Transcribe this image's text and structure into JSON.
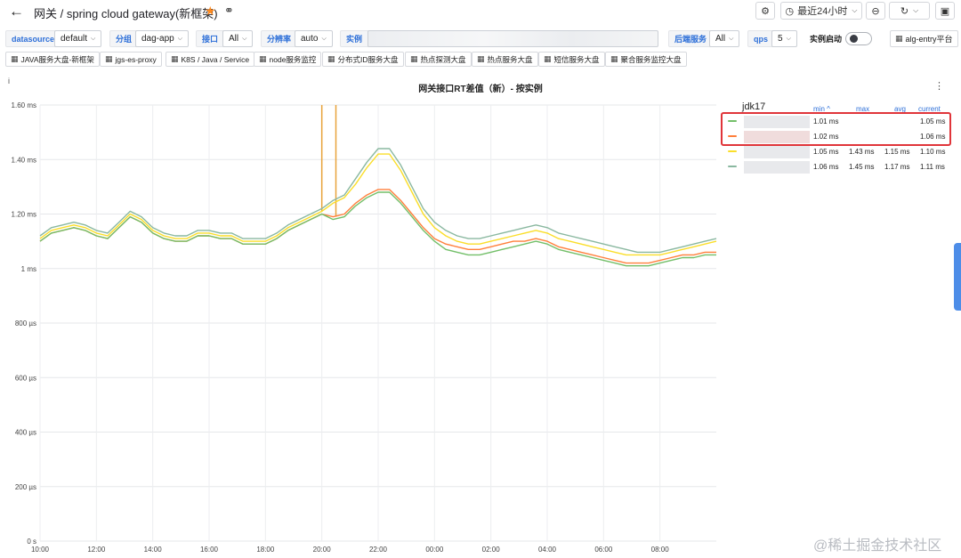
{
  "header": {
    "title": "网关 / spring cloud gateway(新框架)",
    "time_range": "最近24小时",
    "icons": [
      "back-arrow",
      "star",
      "share",
      "settings-gear",
      "clock",
      "zoom-out",
      "refresh",
      "monitor"
    ]
  },
  "variables": [
    {
      "label": "datasource",
      "value": "default",
      "dropdown": true
    },
    {
      "label": "分组",
      "value": "dag-app",
      "dropdown": true
    },
    {
      "label": "接口",
      "value": "All",
      "dropdown": true
    },
    {
      "label": "分辨率",
      "value": "auto",
      "dropdown": true
    },
    {
      "label": "实例",
      "value": ""
    },
    {
      "label": "后端服务",
      "value": "All",
      "dropdown": true
    },
    {
      "label": "qps",
      "value": "5",
      "dropdown": true
    },
    {
      "label": "实例启动",
      "value": ""
    }
  ],
  "alg_link": "alg-entry平台",
  "dashboard_links": [
    "JAVA服务大盘-新框架",
    "jgs-es-proxy",
    "K8S / Java / Service",
    "node服务监控",
    "分布式ID服务大盘",
    "热点探测大盘",
    "热点服务大盘",
    "短信服务大盘",
    "聚合服务监控大盘"
  ],
  "panel": {
    "info": "i",
    "title": "网关接口RT差值（新）- 按实例",
    "menu": "⋮"
  },
  "legend": {
    "title": "jdk17",
    "columns": {
      "min": "min ^",
      "max": "max",
      "avg": "avg",
      "current": "current"
    },
    "rows": [
      {
        "color": "#73bf69",
        "min": "1.01 ms",
        "max": "",
        "avg": "",
        "current": "1.05 ms"
      },
      {
        "color": "#ff7f3b",
        "min": "1.02 ms",
        "max": "",
        "avg": "",
        "current": "1.06 ms"
      },
      {
        "color": "#fade2a",
        "min": "1.05 ms",
        "max": "1.43 ms",
        "avg": "1.15 ms",
        "current": "1.10 ms"
      },
      {
        "color": "#8ab8a0",
        "min": "1.06 ms",
        "max": "1.45 ms",
        "avg": "1.17 ms",
        "current": "1.11 ms"
      }
    ]
  },
  "watermark": "@稀土掘金技术社区",
  "chart_data": {
    "type": "line",
    "y_ticks": [
      "1.60 ms",
      "1.40 ms",
      "1.20 ms",
      "1 ms",
      "800 µs",
      "600 µs",
      "400 µs",
      "200 µs",
      "0 s"
    ],
    "x_ticks": [
      "10:00",
      "12:00",
      "14:00",
      "16:00",
      "18:00",
      "20:00",
      "22:00",
      "00:00",
      "02:00",
      "04:00",
      "06:00",
      "08:00"
    ],
    "ylim": [
      0,
      1.6
    ],
    "y_unit": "ms",
    "x_hours": [
      0,
      0.4,
      0.8,
      1.2,
      1.6,
      2.0,
      2.4,
      2.8,
      3.2,
      3.6,
      4.0,
      4.4,
      4.8,
      5.2,
      5.6,
      6.0,
      6.4,
      6.8,
      7.2,
      7.6,
      8.0,
      8.4,
      8.8,
      9.2,
      9.6,
      10.0,
      10.4,
      10.8,
      11.2,
      11.6,
      12.0,
      12.4,
      12.8,
      13.2,
      13.6,
      14.0,
      14.4,
      14.8,
      15.2,
      15.6,
      16.0,
      16.4,
      16.8,
      17.2,
      17.6,
      18.0,
      18.4,
      18.8,
      19.2,
      19.6,
      20.0,
      20.4,
      20.8,
      21.2,
      21.6,
      22.0,
      22.4,
      22.8,
      23.2,
      23.6,
      24.0
    ],
    "series": [
      {
        "color": "#8ab8a0",
        "values": [
          1.12,
          1.15,
          1.16,
          1.17,
          1.16,
          1.14,
          1.13,
          1.17,
          1.21,
          1.19,
          1.15,
          1.13,
          1.12,
          1.12,
          1.14,
          1.14,
          1.13,
          1.13,
          1.11,
          1.11,
          1.11,
          1.13,
          1.16,
          1.18,
          1.2,
          1.22,
          1.25,
          1.27,
          1.33,
          1.39,
          1.44,
          1.44,
          1.38,
          1.3,
          1.22,
          1.17,
          1.14,
          1.12,
          1.11,
          1.11,
          1.12,
          1.13,
          1.14,
          1.15,
          1.16,
          1.15,
          1.13,
          1.12,
          1.11,
          1.1,
          1.09,
          1.08,
          1.07,
          1.06,
          1.06,
          1.06,
          1.07,
          1.08,
          1.09,
          1.1,
          1.11
        ]
      },
      {
        "color": "#fade2a",
        "values": [
          1.11,
          1.14,
          1.15,
          1.16,
          1.15,
          1.13,
          1.12,
          1.16,
          1.2,
          1.18,
          1.14,
          1.12,
          1.11,
          1.11,
          1.13,
          1.13,
          1.12,
          1.12,
          1.1,
          1.1,
          1.1,
          1.12,
          1.15,
          1.17,
          1.19,
          1.21,
          1.24,
          1.26,
          1.31,
          1.37,
          1.42,
          1.42,
          1.36,
          1.28,
          1.2,
          1.15,
          1.12,
          1.1,
          1.09,
          1.09,
          1.1,
          1.11,
          1.12,
          1.13,
          1.14,
          1.13,
          1.11,
          1.1,
          1.09,
          1.08,
          1.07,
          1.06,
          1.05,
          1.05,
          1.05,
          1.05,
          1.06,
          1.07,
          1.08,
          1.09,
          1.1
        ]
      },
      {
        "color": "#ff7f3b",
        "values": [
          1.1,
          1.13,
          1.14,
          1.15,
          1.14,
          1.12,
          1.11,
          1.15,
          1.19,
          1.17,
          1.13,
          1.11,
          1.1,
          1.1,
          1.12,
          1.12,
          1.11,
          1.11,
          1.09,
          1.09,
          1.09,
          1.11,
          1.14,
          1.16,
          1.18,
          1.2,
          1.19,
          1.2,
          1.24,
          1.27,
          1.29,
          1.29,
          1.25,
          1.2,
          1.15,
          1.11,
          1.09,
          1.08,
          1.07,
          1.07,
          1.08,
          1.09,
          1.1,
          1.1,
          1.11,
          1.1,
          1.08,
          1.07,
          1.06,
          1.05,
          1.04,
          1.03,
          1.02,
          1.02,
          1.02,
          1.03,
          1.04,
          1.05,
          1.05,
          1.06,
          1.06
        ]
      },
      {
        "color": "#73bf69",
        "values": [
          1.1,
          1.13,
          1.14,
          1.15,
          1.14,
          1.12,
          1.11,
          1.15,
          1.19,
          1.17,
          1.13,
          1.11,
          1.1,
          1.1,
          1.12,
          1.12,
          1.11,
          1.11,
          1.09,
          1.09,
          1.09,
          1.11,
          1.14,
          1.16,
          1.18,
          1.2,
          1.18,
          1.19,
          1.23,
          1.26,
          1.28,
          1.28,
          1.24,
          1.19,
          1.14,
          1.1,
          1.07,
          1.06,
          1.05,
          1.05,
          1.06,
          1.07,
          1.08,
          1.09,
          1.1,
          1.09,
          1.07,
          1.06,
          1.05,
          1.04,
          1.03,
          1.02,
          1.01,
          1.01,
          1.01,
          1.02,
          1.03,
          1.04,
          1.04,
          1.05,
          1.05
        ]
      }
    ],
    "spikes": [
      {
        "color": "#e8a33a",
        "x_hour": 10.0,
        "from": 1.21,
        "to": 1.6
      },
      {
        "color": "#e8a33a",
        "x_hour": 10.5,
        "from": 1.19,
        "to": 1.6
      }
    ],
    "grid": true,
    "legend_position": "right"
  }
}
